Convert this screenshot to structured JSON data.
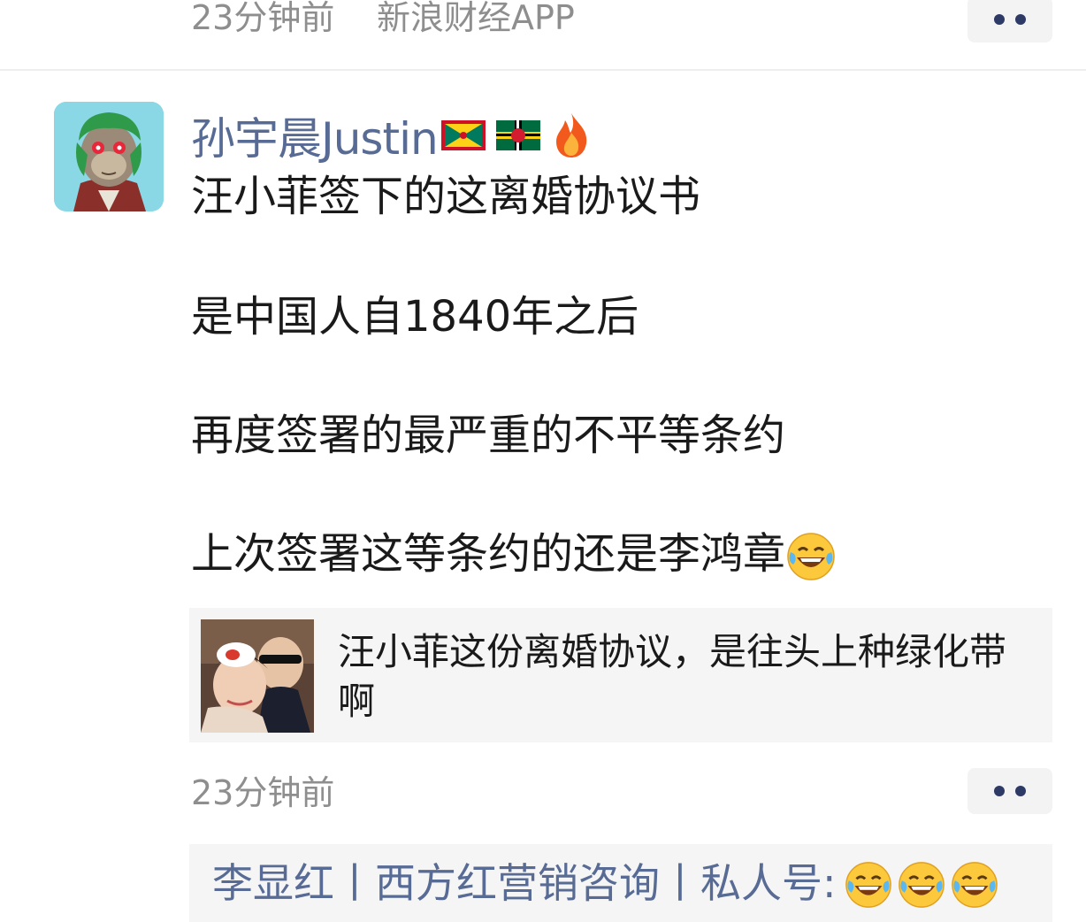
{
  "previous_post": {
    "time": "23分钟前",
    "source": "新浪财经APP"
  },
  "post": {
    "username": "孙宇晨Justin",
    "username_icons": [
      "grenada-flag-icon",
      "dominica-flag-icon",
      "fire-icon"
    ],
    "lines": [
      "汪小菲签下的这离婚协议书",
      "是中国人自1840年之后",
      "再度签署的最严重的不平等条约",
      "上次签署这等条约的还是李鸿章"
    ],
    "last_line_emoji": "laughing-tears-emoji",
    "quote": {
      "text": "汪小菲这份离婚协议，是往头上种绿化带啊"
    },
    "time": "23分钟前"
  },
  "reply": {
    "author": "李显红丨西方红营销咨询丨私人号:",
    "emojis": [
      "laughing-tears-emoji",
      "laughing-tears-emoji",
      "laughing-tears-emoji"
    ]
  },
  "colors": {
    "link_blue": "#576b95",
    "text": "#1a1a1a",
    "meta_gray": "#8e8e8e",
    "card_bg": "#f5f5f5"
  }
}
